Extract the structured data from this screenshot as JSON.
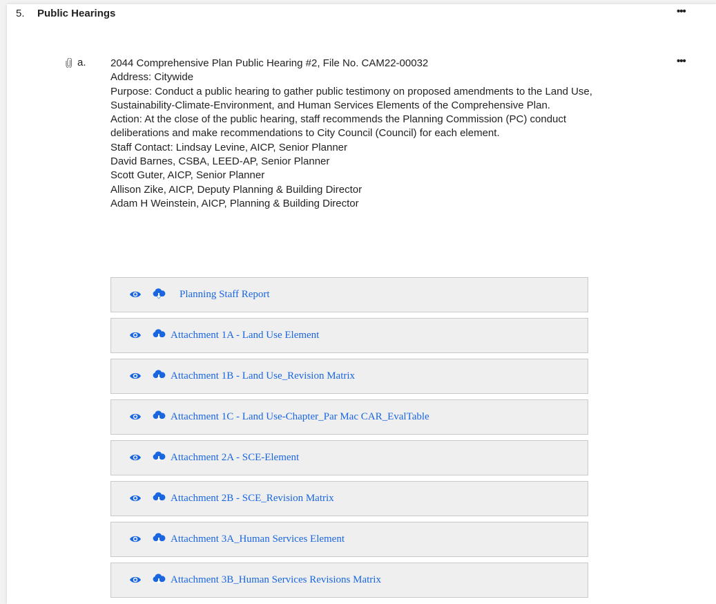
{
  "section": {
    "number": "5.",
    "title": "Public Hearings",
    "more": "•••"
  },
  "item": {
    "letter": "a.",
    "more": "•••",
    "lines": [
      "2044 Comprehensive Plan Public Hearing #2, File No. CAM22-00032",
      "Address: Citywide",
      "Purpose: Conduct a public hearing to gather public testimony on proposed amendments to the Land Use, Sustainability-Climate-Environment, and Human Services Elements of the Comprehensive Plan.",
      "Action: At the close of the public hearing, staff recommends the Planning Commission (PC) conduct deliberations and make recommendations to City Council (Council) for each element.",
      "Staff Contact: Lindsay Levine, AICP, Senior Planner",
      "David Barnes, CSBA, LEED-AP, Senior Planner",
      "Scott Guter, AICP, Senior Planner",
      "Allison Zike, AICP, Deputy Planning & Building Director",
      "Adam H Weinstein, AICP, Planning & Building Director"
    ]
  },
  "attachments": [
    {
      "label": "Planning Staff Report"
    },
    {
      "label": "Attachment 1A - Land Use Element"
    },
    {
      "label": "Attachment 1B - Land Use_Revision Matrix"
    },
    {
      "label": "Attachment 1C - Land Use-Chapter_Par Mac CAR_EvalTable"
    },
    {
      "label": "Attachment 2A - SCE-Element"
    },
    {
      "label": "Attachment 2B - SCE_Revision Matrix"
    },
    {
      "label": "Attachment 3A_Human Services Element"
    },
    {
      "label": "Attachment 3B_Human Services Revisions Matrix"
    }
  ],
  "colors": {
    "link": "#1a66e0",
    "row_bg": "#efefef",
    "row_border": "#c9c9c9"
  },
  "icons": {
    "view": "eye-icon",
    "download": "cloud-download-icon",
    "attachment": "paperclip-icon"
  }
}
